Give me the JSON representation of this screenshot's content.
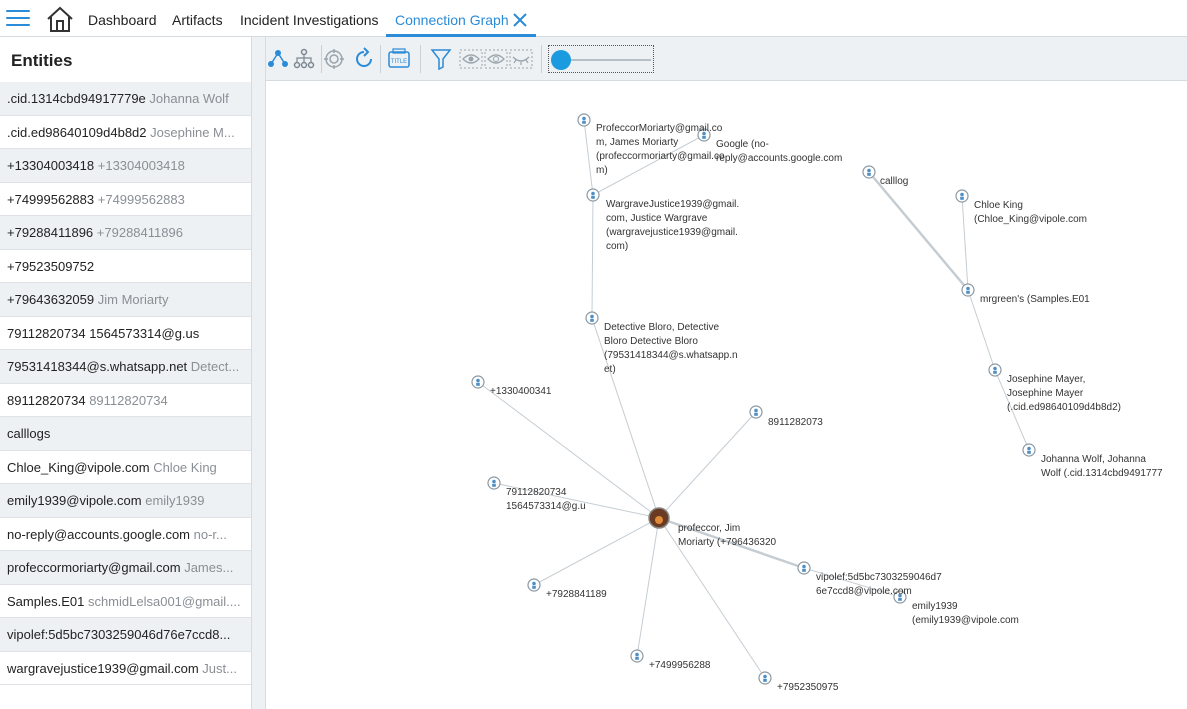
{
  "tabs": {
    "dashboard": "Dashboard",
    "artifacts": "Artifacts",
    "incidents": "Incident Investigations",
    "graph": "Connection Graph"
  },
  "sidebar": {
    "title": "Entities",
    "items": [
      {
        "primary": ".cid.1314cbd94917779e",
        "secondary": "Johanna Wolf"
      },
      {
        "primary": ".cid.ed98640109d4b8d2",
        "secondary": "Josephine M..."
      },
      {
        "primary": "+13304003418",
        "secondary": "+13304003418"
      },
      {
        "primary": "+74999562883",
        "secondary": "+74999562883"
      },
      {
        "primary": "+79288411896",
        "secondary": "+79288411896"
      },
      {
        "primary": "+79523509752",
        "secondary": ""
      },
      {
        "primary": "+79643632059",
        "secondary": "Jim Moriarty"
      },
      {
        "primary": "79112820734",
        "secondary_dark": "1564573314@g.us"
      },
      {
        "primary": "79531418344@s.whatsapp.net",
        "secondary": "Detect..."
      },
      {
        "primary": "89112820734",
        "secondary": "89112820734"
      },
      {
        "primary": "calllogs",
        "secondary": ""
      },
      {
        "primary": "Chloe_King@vipole.com",
        "secondary": "Chloe King"
      },
      {
        "primary": "emily1939@vipole.com",
        "secondary": "emily1939"
      },
      {
        "primary": "no-reply@accounts.google.com",
        "secondary": "no-r..."
      },
      {
        "primary": "profeccormoriarty@gmail.com",
        "secondary": "James..."
      },
      {
        "primary": "Samples.E01",
        "secondary": "schmidLelsa001@gmail...."
      },
      {
        "primary": "vipolef:5d5bc7303259046d76e7ccd8...",
        "secondary": ""
      },
      {
        "primary": "wargravejustice1939@gmail.com",
        "secondary": "Just..."
      }
    ]
  },
  "toolbar": {
    "icons": [
      "layout-tree-icon",
      "layout-hierarchy-icon",
      "target-icon",
      "refresh-icon",
      "title-icon",
      "filter-icon",
      "show-all-icon",
      "show-selected-icon",
      "hide-icon"
    ],
    "title_icon_text": "TITLE"
  },
  "graph": {
    "center": {
      "label": "profeccor, Jim\nMoriarty (+796436320",
      "icon": "avatar-photo-icon"
    },
    "nodes": [
      {
        "id": "prof",
        "label": "ProfeccorMoriarty@gmail.co\nm, James Moriarty\n(profeccormoriarty@gmail.co\nm)"
      },
      {
        "id": "google",
        "label": "Google (no-\nreply@accounts.google.com"
      },
      {
        "id": "wargrave",
        "label": "WargraveJustice1939@gmail.\ncom, Justice Wargrave\n(wargravejustice1939@gmail.\ncom)"
      },
      {
        "id": "calllog",
        "label": "calllog"
      },
      {
        "id": "chloe",
        "label": "Chloe King\n(Chloe_King@vipole.com"
      },
      {
        "id": "mrgreen",
        "label": "mrgreen's (Samples.E01"
      },
      {
        "id": "detective",
        "label": "Detective Bloro, Detective\nBloro Detective Bloro\n(79531418344@s.whatsapp.n\net)"
      },
      {
        "id": "josephine",
        "label": "Josephine Mayer,\nJosephine Mayer\n(.cid.ed98640109d4b8d2)"
      },
      {
        "id": "johanna",
        "label": "Johanna Wolf, Johanna\nWolf (.cid.1314cbd9491777"
      },
      {
        "id": "n1330",
        "label": "+1330400341"
      },
      {
        "id": "n8911",
        "label": "8911282073"
      },
      {
        "id": "n7911",
        "label": "79112820734\n1564573314@g.u"
      },
      {
        "id": "vipolef",
        "label": "vipolef:5d5bc7303259046d7\n6e7ccd8@vipole.com"
      },
      {
        "id": "emily",
        "label": "emily1939\n(emily1939@vipole.com"
      },
      {
        "id": "n7928",
        "label": "+7928841189"
      },
      {
        "id": "n7499",
        "label": "+7499956288"
      },
      {
        "id": "n7952",
        "label": "+7952350975"
      }
    ]
  }
}
